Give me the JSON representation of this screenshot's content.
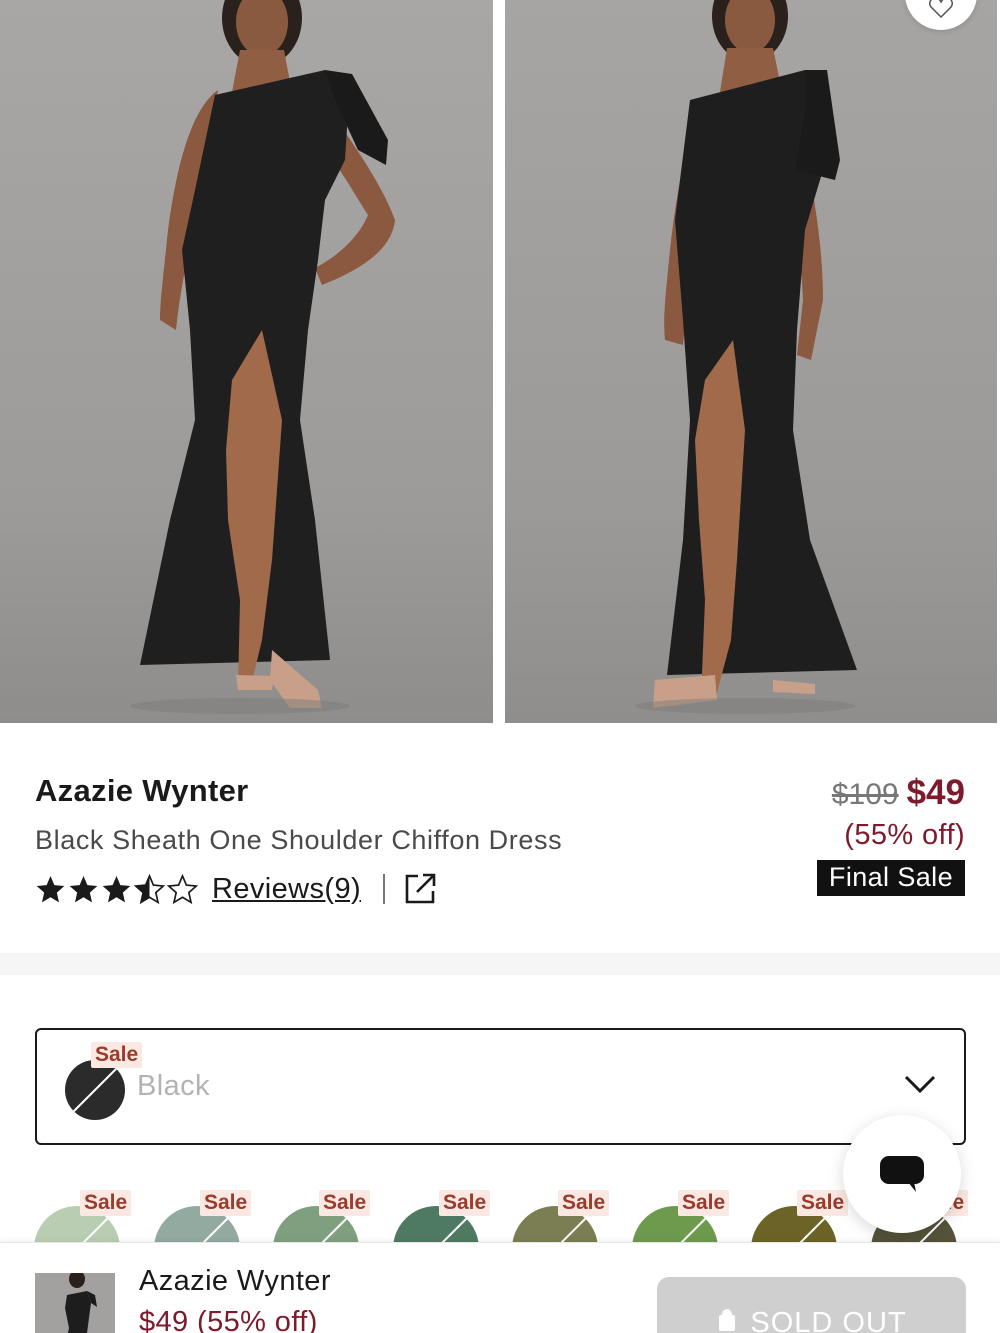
{
  "product": {
    "brand": "Azazie Wynter",
    "name": "Black Sheath One Shoulder Chiffon Dress",
    "rating": 3.5,
    "rating_max": 5,
    "reviews_label": "Reviews(9)"
  },
  "price": {
    "original": "$109",
    "sale": "$49",
    "discount": "(55% off)",
    "badge": "Final Sale"
  },
  "color": {
    "sale_tag": "Sale",
    "selected": "Black",
    "swatch_hex": "#2b2b2b"
  },
  "swatches": [
    {
      "tag": "Sale",
      "hex": "#b9cdb2"
    },
    {
      "tag": "Sale",
      "hex": "#93aaa0"
    },
    {
      "tag": "Sale",
      "hex": "#7fa07f"
    },
    {
      "tag": "Sale",
      "hex": "#4f7a62"
    },
    {
      "tag": "Sale",
      "hex": "#7b7e52"
    },
    {
      "tag": "Sale",
      "hex": "#6e9a4e"
    },
    {
      "tag": "Sale",
      "hex": "#6b6426"
    },
    {
      "tag": "Sale",
      "hex": "#56533a"
    }
  ],
  "sticky": {
    "brand": "Azazie Wynter",
    "price": "$49 (55% off)",
    "cta": "SOLD OUT"
  },
  "colors": {
    "accent": "#7d1a2c",
    "sale_bg": "#fbe8e2",
    "sale_text": "#9a3b2c"
  },
  "icons": {
    "wishlist": "heart-icon",
    "share": "external-link-icon",
    "dropdown": "chevron-down-icon",
    "chat": "chat-bubble-icon"
  }
}
